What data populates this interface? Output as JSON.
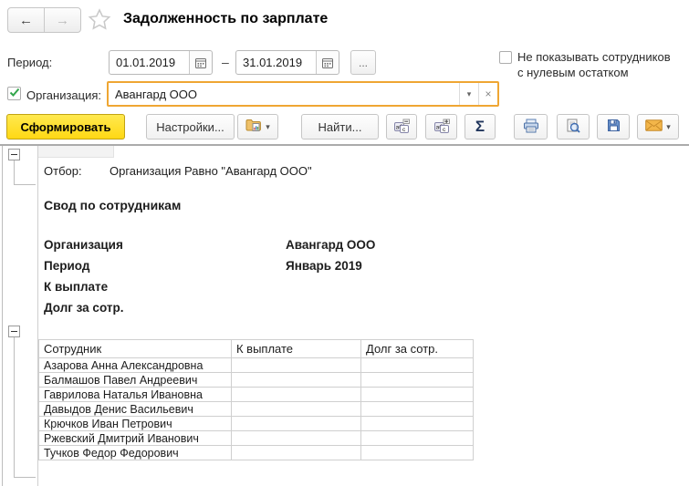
{
  "window": {
    "title": "Задолженность по зарплате"
  },
  "nav": {
    "back_glyph": "←",
    "forward_glyph": "→"
  },
  "filters": {
    "period": {
      "label": "Период:",
      "from": "01.01.2019",
      "separator": "–",
      "to": "31.01.2019",
      "more_button": "..."
    },
    "hide_zero": {
      "checked": false,
      "label_line1": "Не показывать сотрудников",
      "label_line2": "с нулевым остатком"
    },
    "organization": {
      "checked": true,
      "label": "Организация:",
      "value": "Авангард ООО",
      "dropdown_glyph": "▾",
      "clear_glyph": "×"
    }
  },
  "toolbar": {
    "generate_label": "Сформировать",
    "settings_label": "Настройки...",
    "find_label": "Найти...",
    "sum_glyph": "Σ",
    "dropdown_glyph": "▾",
    "icon_names": [
      "report-variants-icon",
      "collapse-groups-icon",
      "expand-groups-icon",
      "sum-icon",
      "print-icon",
      "preview-icon",
      "save-icon",
      "email-icon"
    ]
  },
  "report": {
    "filter_row": {
      "label": "Отбор:",
      "value": "Организация Равно \"Авангард ООО\""
    },
    "section_title": "Свод по сотрудникам",
    "info_rows": [
      {
        "label": "Организация",
        "value": "Авангард ООО"
      },
      {
        "label": "Период",
        "value": "Январь 2019"
      },
      {
        "label": "К выплате",
        "value": ""
      },
      {
        "label": "Долг за сотр.",
        "value": ""
      }
    ],
    "table": {
      "columns": [
        "Сотрудник",
        "К выплате",
        "Долг за сотр."
      ],
      "rows": [
        {
          "name": "Азарова Анна Александровна",
          "to_pay": "",
          "debt": ""
        },
        {
          "name": "Балмашов Павел Андреевич",
          "to_pay": "",
          "debt": ""
        },
        {
          "name": "Гаврилова Наталья Ивановна",
          "to_pay": "",
          "debt": ""
        },
        {
          "name": "Давыдов Денис Васильевич",
          "to_pay": "",
          "debt": ""
        },
        {
          "name": "Крючков Иван Петрович",
          "to_pay": "",
          "debt": ""
        },
        {
          "name": "Ржевский Дмитрий Иванович",
          "to_pay": "",
          "debt": ""
        },
        {
          "name": "Тучков Федор Федорович",
          "to_pay": "",
          "debt": ""
        }
      ]
    }
  },
  "colors": {
    "accent_yellow": "#FFD814",
    "field_highlight_border": "#EFA633",
    "check_green": "#33A64C",
    "icon_blue": "#3E6CB0",
    "envelope_orange": "#F3B64A",
    "separator_gray": "#ABABAB",
    "table_border": "#CFCFCF"
  }
}
